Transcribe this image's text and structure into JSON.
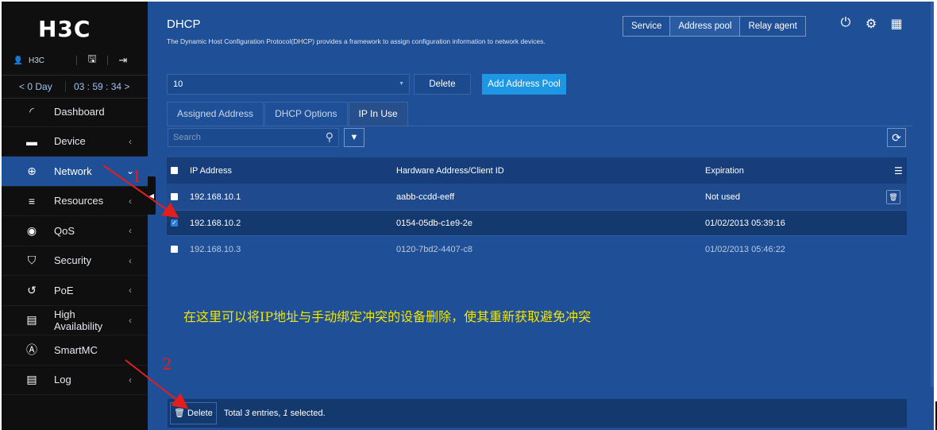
{
  "brand": {
    "logo": "H3C",
    "user": "H3C"
  },
  "session": {
    "days": "< 0 Day",
    "time": "03 : 59 : 34 >"
  },
  "sidebar": {
    "items": [
      {
        "label": "Dashboard",
        "icon": "gauge-icon",
        "glyph": "◜",
        "chev": ""
      },
      {
        "label": "Device",
        "icon": "device-icon",
        "glyph": "▬",
        "chev": "‹"
      },
      {
        "label": "Network",
        "icon": "globe-icon",
        "glyph": "⊕",
        "chev": "⌄"
      },
      {
        "label": "Resources",
        "icon": "database-icon",
        "glyph": "≡",
        "chev": "‹"
      },
      {
        "label": "QoS",
        "icon": "qos-icon",
        "glyph": "◉",
        "chev": "‹"
      },
      {
        "label": "Security",
        "icon": "shield-icon",
        "glyph": "⛉",
        "chev": "‹"
      },
      {
        "label": "PoE",
        "icon": "poe-icon",
        "glyph": "↺",
        "chev": "‹"
      },
      {
        "label": "High Availability",
        "icon": "document-icon",
        "glyph": "▤",
        "chev": "‹"
      },
      {
        "label": "SmartMC",
        "icon": "smartmc-icon",
        "glyph": "Ⓐ",
        "chev": ""
      },
      {
        "label": "Log",
        "icon": "log-icon",
        "glyph": "▤",
        "chev": "‹"
      }
    ]
  },
  "header": {
    "title": "DHCP",
    "description": "The Dynamic Host Configuration Protocol(DHCP) provides a framework to assign configuration information to network devices.",
    "segments": [
      "Service",
      "Address pool",
      "Relay agent"
    ]
  },
  "toolbar": {
    "pool_value": "10",
    "delete_label": "Delete",
    "add_label": "Add Address Pool"
  },
  "tabs": [
    "Assigned Address",
    "DHCP Options",
    "IP In Use"
  ],
  "search": {
    "placeholder": "Search"
  },
  "table": {
    "columns": [
      "IP Address",
      "Hardware Address/Client ID",
      "Expiration"
    ],
    "rows": [
      {
        "ip": "192.168.10.1",
        "hw": "aabb-ccdd-eeff",
        "exp": "Not used",
        "checked": false
      },
      {
        "ip": "192.168.10.2",
        "hw": "0154-05db-c1e9-2e",
        "exp": "01/02/2013 05:39:16",
        "checked": true
      },
      {
        "ip": "192.168.10.3",
        "hw": "0120-7bd2-4407-c8",
        "exp": "01/02/2013 05:46:22",
        "checked": false
      }
    ]
  },
  "annotation": {
    "text": "在这里可以将IP地址与手动绑定冲突的设备删除，使其重新获取避免冲突",
    "mark1": "1",
    "mark2": "2"
  },
  "footer": {
    "delete_label": "Delete",
    "total_prefix": "Total ",
    "total_count": "3",
    "total_mid": " entries, ",
    "selected_count": "1",
    "total_suffix": " selected."
  },
  "colors": {
    "sidebar_bg": "#0f0f10",
    "content_bg": "#1f4f96",
    "accent": "#1d97e3",
    "annotation": "#f2e600",
    "arrow": "#e31e1e"
  }
}
